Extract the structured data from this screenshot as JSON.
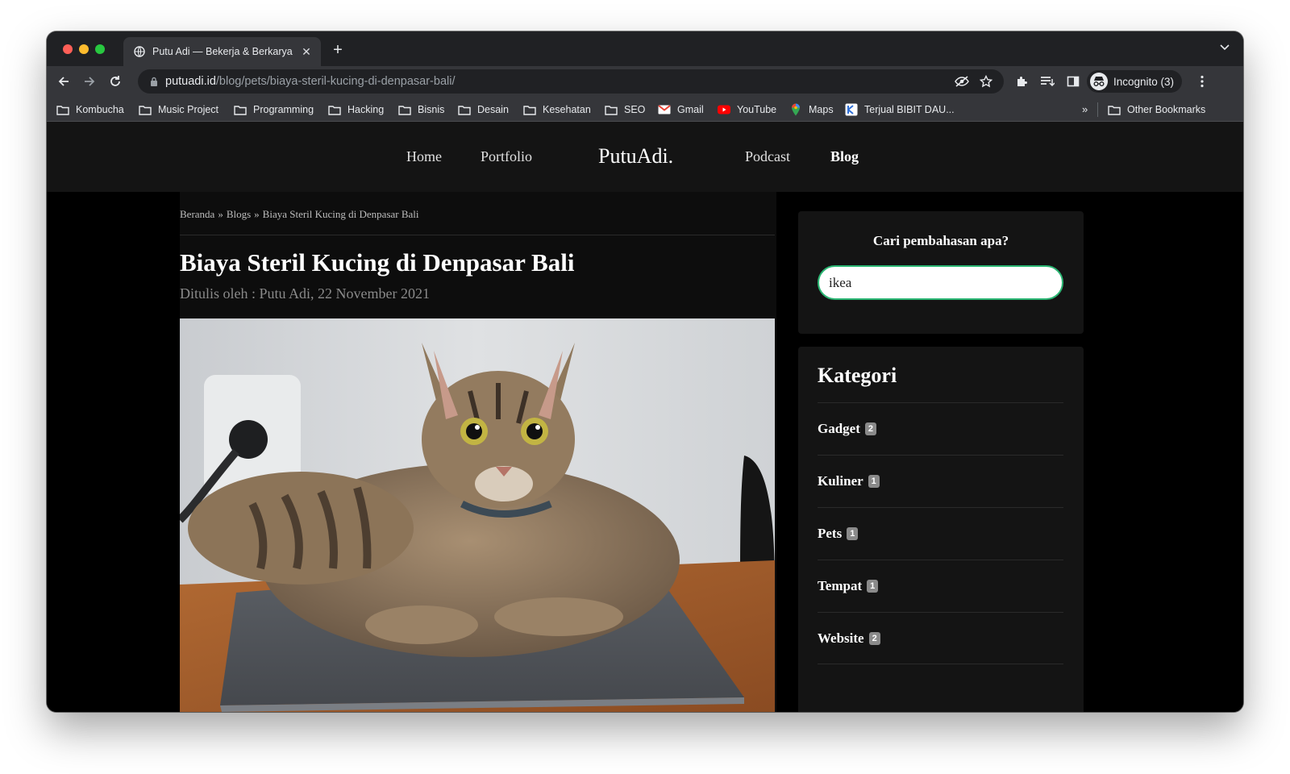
{
  "browser": {
    "tab_title": "Putu Adi — Bekerja & Berkarya",
    "url_host": "putuadi.id",
    "url_path": "/blog/pets/biaya-steril-kucing-di-denpasar-bali/",
    "profile_label": "Incognito (3)",
    "bookmarks": [
      {
        "label": "Kombucha",
        "icon": "folder-icon"
      },
      {
        "label": "Music Project",
        "icon": "folder-icon"
      },
      {
        "label": "Programming",
        "icon": "folder-icon"
      },
      {
        "label": "Hacking",
        "icon": "folder-icon"
      },
      {
        "label": "Bisnis",
        "icon": "folder-icon"
      },
      {
        "label": "Desain",
        "icon": "folder-icon"
      },
      {
        "label": "Kesehatan",
        "icon": "folder-icon"
      },
      {
        "label": "SEO",
        "icon": "folder-icon"
      },
      {
        "label": "Gmail",
        "icon": "gmail-icon"
      },
      {
        "label": "YouTube",
        "icon": "youtube-icon"
      },
      {
        "label": "Maps",
        "icon": "maps-icon"
      },
      {
        "label": "Terjual BIBIT DAU...",
        "icon": "store-icon"
      }
    ],
    "bookmarks_overflow": "»",
    "other_bookmarks": "Other Bookmarks"
  },
  "site": {
    "logo": "PutuAdi.",
    "nav": {
      "home": "Home",
      "portfolio": "Portfolio",
      "podcast": "Podcast",
      "blog": "Blog"
    }
  },
  "post": {
    "breadcrumb": [
      "Beranda",
      "Blogs",
      "Biaya Steril Kucing di Denpasar Bali"
    ],
    "breadcrumb_separator": "»",
    "title": "Biaya Steril Kucing di Denpasar Bali",
    "meta": "Ditulis oleh : Putu Adi, 22 November 2021"
  },
  "sidebar": {
    "search_heading": "Cari pembahasan apa?",
    "search_value": "ikea",
    "categories_heading": "Kategori",
    "categories": [
      {
        "name": "Gadget",
        "count": "2"
      },
      {
        "name": "Kuliner",
        "count": "1"
      },
      {
        "name": "Pets",
        "count": "1"
      },
      {
        "name": "Tempat",
        "count": "1"
      },
      {
        "name": "Website",
        "count": "2"
      }
    ]
  },
  "colors": {
    "accent_search_border": "#2bb673",
    "page_background": "#000000",
    "header_background": "#141414"
  }
}
